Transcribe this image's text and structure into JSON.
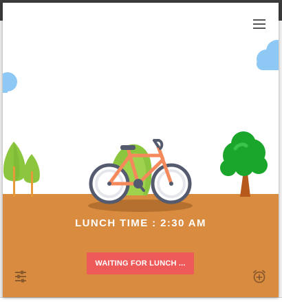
{
  "header": {
    "menu_icon": "hamburger-menu-icon"
  },
  "main": {
    "lunch_time_label": "LUNCH TIME : 2:30 AM",
    "waiting_button_label": "WAITING FOR LUNCH ..."
  },
  "footer": {
    "left_icon": "tune-settings-icon",
    "right_icon": "add-alarm-icon"
  },
  "colors": {
    "ground": "#d98c3f",
    "button": "#ee5959",
    "sky_cloud": "#8ec9f5",
    "bike_frame": "#f4895c",
    "tree_green": "#1aa52b"
  }
}
